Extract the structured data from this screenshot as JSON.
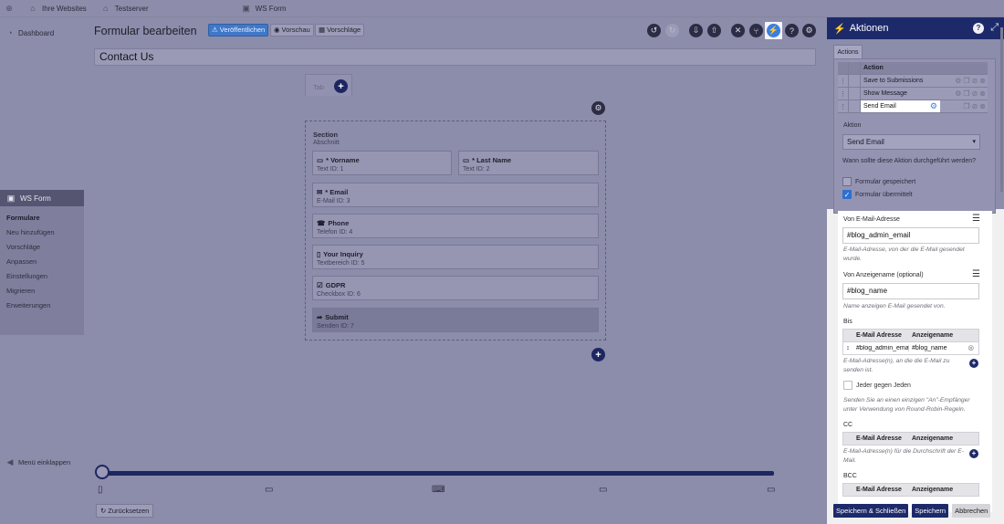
{
  "topbar": {
    "site_label": "Ihre Websites",
    "server_label": "Testserver",
    "plugin_label": "WS Form"
  },
  "sidebar": {
    "dashboard": "Dashboard",
    "plugin": "WS Form",
    "items": [
      {
        "label": "Formulare"
      },
      {
        "label": "Neu hinzufügen"
      },
      {
        "label": "Vorschläge"
      },
      {
        "label": "Anpassen"
      },
      {
        "label": "Einstellungen"
      },
      {
        "label": "Migrieren"
      },
      {
        "label": "Erweiterungen"
      }
    ],
    "collapse": "Menü einklappen"
  },
  "editor": {
    "title": "Formular bearbeiten",
    "publish": "Veröffentlichen",
    "preview": "Vorschau",
    "suggestions": "Vorschläge",
    "form_name": "Contact Us",
    "tab_label": "Tab",
    "section_title": "Section",
    "section_sub": "Abschnitt",
    "reset": "Zurücksetzen"
  },
  "fields": [
    {
      "label": "* Vorname",
      "sub": "Text  ID: 1"
    },
    {
      "label": "* Last Name",
      "sub": "Text  ID: 2"
    },
    {
      "label": "* Email",
      "sub": "E-Mail  ID: 3"
    },
    {
      "label": "Phone",
      "sub": "Telefon  ID: 4"
    },
    {
      "label": "Your Inquiry",
      "sub": "Textbereich  ID: 5"
    },
    {
      "label": "GDPR",
      "sub": "Checkbox  ID: 6"
    },
    {
      "label": "Submit",
      "sub": "Senden  ID: 7"
    }
  ],
  "panel": {
    "title": "Aktionen",
    "tab": "Actions",
    "col_action": "Action",
    "actions": [
      "Save to Submissions",
      "Show Message",
      "Send Email"
    ],
    "aktion_label": "Aktion",
    "aktion_value": "Send Email",
    "question": "Wann sollte diese Aktion durchgeführt werden?",
    "cb1": "Formular gespeichert",
    "cb2": "Formular übermittelt",
    "from_email_label": "Von E-Mail-Adresse",
    "from_email_value": "#blog_admin_email",
    "from_email_help": "E-Mail-Adresse, von der die E-Mail gesendet wurde.",
    "from_name_label": "Von Anzeigename (optional)",
    "from_name_value": "#blog_name",
    "from_name_help": "Name anzeigen E-Mail gesendet von.",
    "to_label": "Bis",
    "col_email": "E-Mail Adresse",
    "col_name": "Anzeigename",
    "to_email": "#blog_admin_email",
    "to_name": "#blog_name",
    "to_help": "E-Mail-Adresse(n), an die die E-Mail zu senden ist.",
    "each_label": "Jeder gegen Jeden",
    "each_help": "Senden Sie an einen einzigen \"An\"-Empfänger unter Verwendung von Round-Robin-Regeln.",
    "cc_label": "CC",
    "cc_help": "E-Mail-Adresse(n) für die Durchschrift der E-Mail.",
    "bcc_label": "BCC",
    "btn_save_close": "Speichern & Schließen",
    "btn_save": "Speichern",
    "btn_cancel": "Abbrechen"
  }
}
